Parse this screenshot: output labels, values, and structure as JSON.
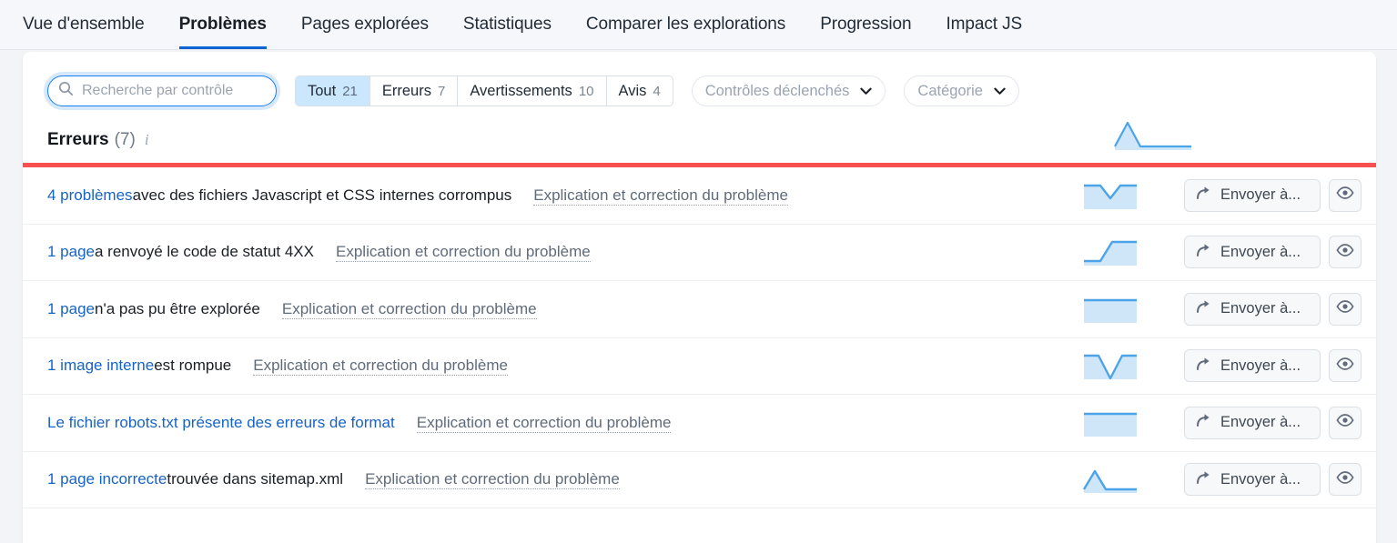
{
  "tabs": [
    {
      "label": "Vue d'ensemble",
      "active": false
    },
    {
      "label": "Problèmes",
      "active": true
    },
    {
      "label": "Pages explorées",
      "active": false
    },
    {
      "label": "Statistiques",
      "active": false
    },
    {
      "label": "Comparer les explorations",
      "active": false
    },
    {
      "label": "Progression",
      "active": false
    },
    {
      "label": "Impact JS",
      "active": false
    }
  ],
  "search": {
    "placeholder": "Recherche par contrôle",
    "value": "",
    "icon": "search-icon"
  },
  "segmented": [
    {
      "label": "Tout",
      "count": "21",
      "active": true
    },
    {
      "label": "Erreurs",
      "count": "7",
      "active": false
    },
    {
      "label": "Avertissements",
      "count": "10",
      "active": false
    },
    {
      "label": "Avis",
      "count": "4",
      "active": false
    }
  ],
  "dropdowns": [
    {
      "label": "Contrôles déclenchés",
      "icon": "chevron-down-icon"
    },
    {
      "label": "Catégorie",
      "icon": "chevron-down-icon"
    }
  ],
  "section": {
    "title": "Erreurs",
    "count": "(7)",
    "info_icon": "info-icon",
    "accent_color": "#f8504f"
  },
  "row_actions": {
    "send_label": "Envoyer à...",
    "send_icon": "share-arrow-icon",
    "eye_icon": "eye-icon"
  },
  "rows": [
    {
      "link": "4 problèmes",
      "rest": " avec des fichiers Javascript et CSS internes corrompus",
      "explain": "Explication et correction du problème",
      "sparkline": "dip"
    },
    {
      "link": "1 page",
      "rest": " a renvoyé le code de statut 4XX",
      "explain": "Explication et correction du problème",
      "sparkline": "rise"
    },
    {
      "link": "1 page",
      "rest": " n'a pas pu être explorée",
      "explain": "Explication et correction du problème",
      "sparkline": "flat"
    },
    {
      "link": "1 image interne",
      "rest": " est rompue",
      "explain": "Explication et correction du problème",
      "sparkline": "deepdip"
    },
    {
      "link": "Le fichier robots.txt présente des erreurs de format",
      "rest": "",
      "explain": "Explication et correction du problème",
      "sparkline": "flat"
    },
    {
      "link": "1 page incorrecte",
      "rest": " trouvée dans sitemap.xml",
      "explain": "Explication et correction du problème",
      "sparkline": "peak"
    }
  ],
  "sparkline_header": "peak",
  "colors": {
    "accent_blue": "#1063d4",
    "link_blue": "#1763c6",
    "spark_line": "#4ba3e8",
    "spark_fill": "#cfe6f9",
    "error_red": "#f8504f"
  }
}
